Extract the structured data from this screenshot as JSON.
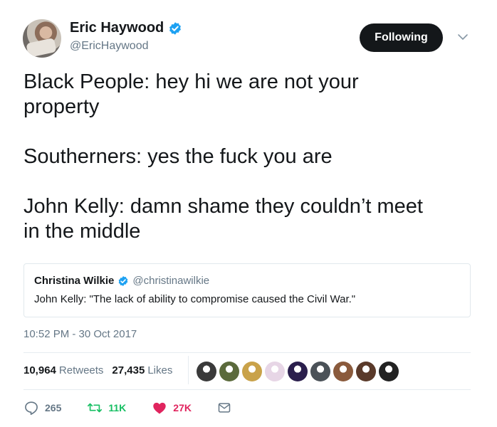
{
  "author": {
    "name": "Eric Haywood",
    "handle": "@EricHaywood",
    "verified": true,
    "avatar_icon": "user-avatar"
  },
  "follow_button": {
    "label": "Following"
  },
  "menu": {
    "icon": "chevron-down-icon"
  },
  "tweet": {
    "lines": [
      "Black People: hey hi we are not your",
      "property",
      "Southerners: yes the fuck you are",
      "John Kelly: damn shame they couldn’t meet",
      "in the middle"
    ]
  },
  "quoted_tweet": {
    "name": "Christina Wilkie",
    "handle": "@christinawilkie",
    "verified": true,
    "text": "John Kelly: \"The lack of ability to compromise caused the Civil War.\""
  },
  "timestamp": "10:52 PM - 30 Oct 2017",
  "stats": {
    "retweets_count": "10,964",
    "retweets_label": "Retweets",
    "likes_count": "27,435",
    "likes_label": "Likes"
  },
  "likers": [
    {
      "name": "liker-avatar-1",
      "color": "#3a3a3a"
    },
    {
      "name": "liker-avatar-2",
      "color": "#5b6a3c"
    },
    {
      "name": "liker-avatar-3",
      "color": "#c9a24a"
    },
    {
      "name": "liker-avatar-4",
      "color": "#e7d6e6"
    },
    {
      "name": "liker-avatar-5",
      "color": "#2b1f4d"
    },
    {
      "name": "liker-avatar-6",
      "color": "#4b5258"
    },
    {
      "name": "liker-avatar-7",
      "color": "#8a5a3c"
    },
    {
      "name": "liker-avatar-8",
      "color": "#5a3a2a"
    },
    {
      "name": "liker-avatar-9",
      "color": "#222222"
    }
  ],
  "actions": {
    "replies": "265",
    "retweets": "11K",
    "likes": "27K"
  },
  "colors": {
    "verified_blue": "#1da1f2",
    "retweet_green": "#17bf63",
    "like_red": "#e0245e",
    "muted_text": "#657786"
  }
}
